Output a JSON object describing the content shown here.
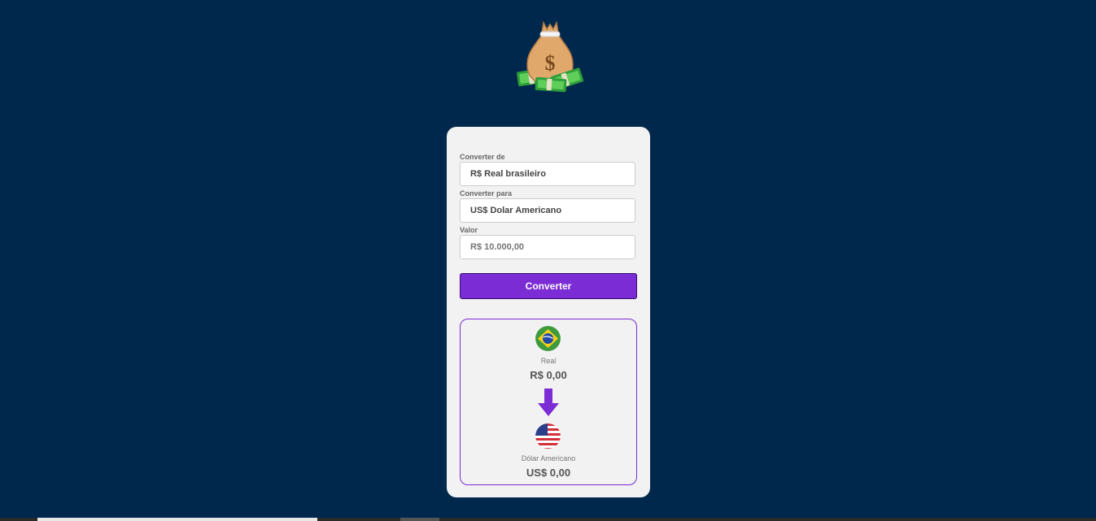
{
  "logo": {
    "icon": "money-bag-icon"
  },
  "form": {
    "from_label": "Converter de",
    "from_value": "R$ Real brasileiro",
    "to_label": "Converter para",
    "to_value": "US$ Dolar Americano",
    "amount_label": "Valor",
    "amount_placeholder": "R$ 10.000,00",
    "convert_button": "Converter"
  },
  "result": {
    "source": {
      "flag": "brazil-flag-icon",
      "name": "Real",
      "value": "R$ 0,00"
    },
    "arrow": "arrow-down-icon",
    "target": {
      "flag": "usa-flag-icon",
      "name": "Dólar Americano",
      "value": "US$ 0,00"
    }
  },
  "colors": {
    "background": "#00284d",
    "card": "#f2f2f2",
    "accent": "#7b2cd4"
  }
}
